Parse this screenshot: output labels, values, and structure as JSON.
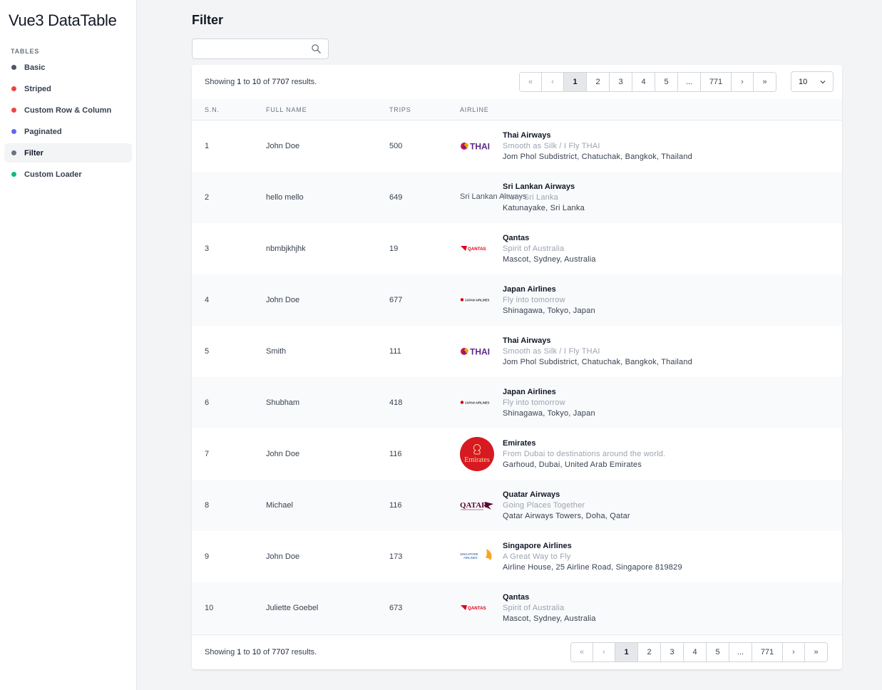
{
  "app": {
    "brand": "Vue3 DataTable"
  },
  "sidebar": {
    "heading": "TABLES",
    "items": [
      {
        "label": "Basic",
        "color": "#4b5563",
        "active": false
      },
      {
        "label": "Striped",
        "color": "#ef4444",
        "active": false
      },
      {
        "label": "Custom Row & Column",
        "color": "#ef4444",
        "active": false
      },
      {
        "label": "Paginated",
        "color": "#6366f1",
        "active": false
      },
      {
        "label": "Filter",
        "color": "#6b7280",
        "active": true
      },
      {
        "label": "Custom Loader",
        "color": "#10b981",
        "active": false
      }
    ]
  },
  "main": {
    "title": "Filter",
    "search": {
      "value": "",
      "placeholder": ""
    },
    "summary": {
      "prefix": "Showing",
      "from": "1",
      "to_word": "to",
      "to": "10",
      "of_word": "of",
      "total": "7707",
      "suffix": "results."
    },
    "pagination": {
      "first": "«",
      "prev": "‹",
      "pages": [
        "1",
        "2",
        "3",
        "4",
        "5"
      ],
      "ellipsis": "...",
      "last_page": "771",
      "next": "›",
      "last": "»",
      "current": "1"
    },
    "per_page": "10",
    "columns": {
      "sn": "S.N.",
      "name": "FULL NAME",
      "trips": "TRIPS",
      "airline": "AIRLINE"
    },
    "rows": [
      {
        "sn": "1",
        "name": "John Doe",
        "trips": "500",
        "logo": "thai",
        "airline": "Thai Airways",
        "slogan": "Smooth as Silk / I Fly THAI",
        "address": "Jom Phol Subdistrict, Chatuchak, Bangkok, Thailand"
      },
      {
        "sn": "2",
        "name": "hello mello",
        "trips": "649",
        "logo": "broken",
        "logo_alt": "Sri Lankan Airways",
        "airline": "Sri Lankan Airways",
        "slogan": "From Sri Lanka",
        "address": "Katunayake, Sri Lanka"
      },
      {
        "sn": "3",
        "name": "nbmbjkhjhk",
        "trips": "19",
        "logo": "qantas",
        "airline": "Qantas",
        "slogan": "Spirit of Australia",
        "address": "Mascot, Sydney, Australia"
      },
      {
        "sn": "4",
        "name": "John Doe",
        "trips": "677",
        "logo": "jal",
        "airline": "Japan Airlines",
        "slogan": "Fly into tomorrow",
        "address": "Shinagawa, Tokyo, Japan"
      },
      {
        "sn": "5",
        "name": "Smith",
        "trips": "111",
        "logo": "thai",
        "airline": "Thai Airways",
        "slogan": "Smooth as Silk / I Fly THAI",
        "address": "Jom Phol Subdistrict, Chatuchak, Bangkok, Thailand"
      },
      {
        "sn": "6",
        "name": "Shubham",
        "trips": "418",
        "logo": "jal",
        "airline": "Japan Airlines",
        "slogan": "Fly into tomorrow",
        "address": "Shinagawa, Tokyo, Japan"
      },
      {
        "sn": "7",
        "name": "John Doe",
        "trips": "116",
        "logo": "emirates",
        "airline": "Emirates",
        "slogan": "From Dubai to destinations around the world.",
        "address": "Garhoud, Dubai, United Arab Emirates"
      },
      {
        "sn": "8",
        "name": "Michael",
        "trips": "116",
        "logo": "qatar",
        "airline": "Quatar Airways",
        "slogan": "Going Places Together",
        "address": "Qatar Airways Towers, Doha, Qatar"
      },
      {
        "sn": "9",
        "name": "John Doe",
        "trips": "173",
        "logo": "singapore",
        "airline": "Singapore Airlines",
        "slogan": "A Great Way to Fly",
        "address": "Airline House, 25 Airline Road, Singapore 819829"
      },
      {
        "sn": "10",
        "name": "Juliette Goebel",
        "trips": "673",
        "logo": "qantas",
        "airline": "Qantas",
        "slogan": "Spirit of Australia",
        "address": "Mascot, Sydney, Australia"
      }
    ]
  },
  "logos": {
    "thai": {
      "text": "THAI",
      "color": "#5b2a86"
    },
    "qantas": {
      "text": "QANTAS",
      "color": "#e0001b"
    },
    "jal": {
      "text": "JAPAN AIRLINES",
      "color": "#cc0000"
    },
    "emirates": {
      "text": "Emirates",
      "color": "#d71921"
    },
    "qatar": {
      "text": "QATAR",
      "color": "#5c0632"
    },
    "singapore": {
      "text": "SINGAPORE AIRLINES",
      "color": "#1d4f91"
    }
  }
}
